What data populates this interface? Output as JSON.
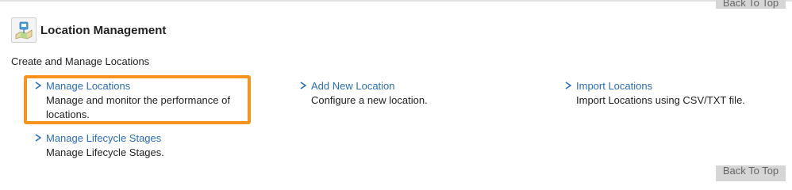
{
  "back_to_top_label": "Back To Top",
  "section": {
    "title": "Location Management",
    "description": "Create and Manage Locations",
    "icon": "location-map-icon"
  },
  "items": [
    {
      "label": "Manage Locations",
      "description": "Manage and monitor the performance of locations.",
      "highlighted": true
    },
    {
      "label": "Add New Location",
      "description": "Configure a new location."
    },
    {
      "label": "Import Locations",
      "description": "Import Locations using CSV/TXT file."
    },
    {
      "label": "Manage Lifecycle Stages",
      "description": "Manage Lifecycle Stages."
    }
  ],
  "colors": {
    "link": "#2a6ebb",
    "highlight": "#f7931e"
  }
}
